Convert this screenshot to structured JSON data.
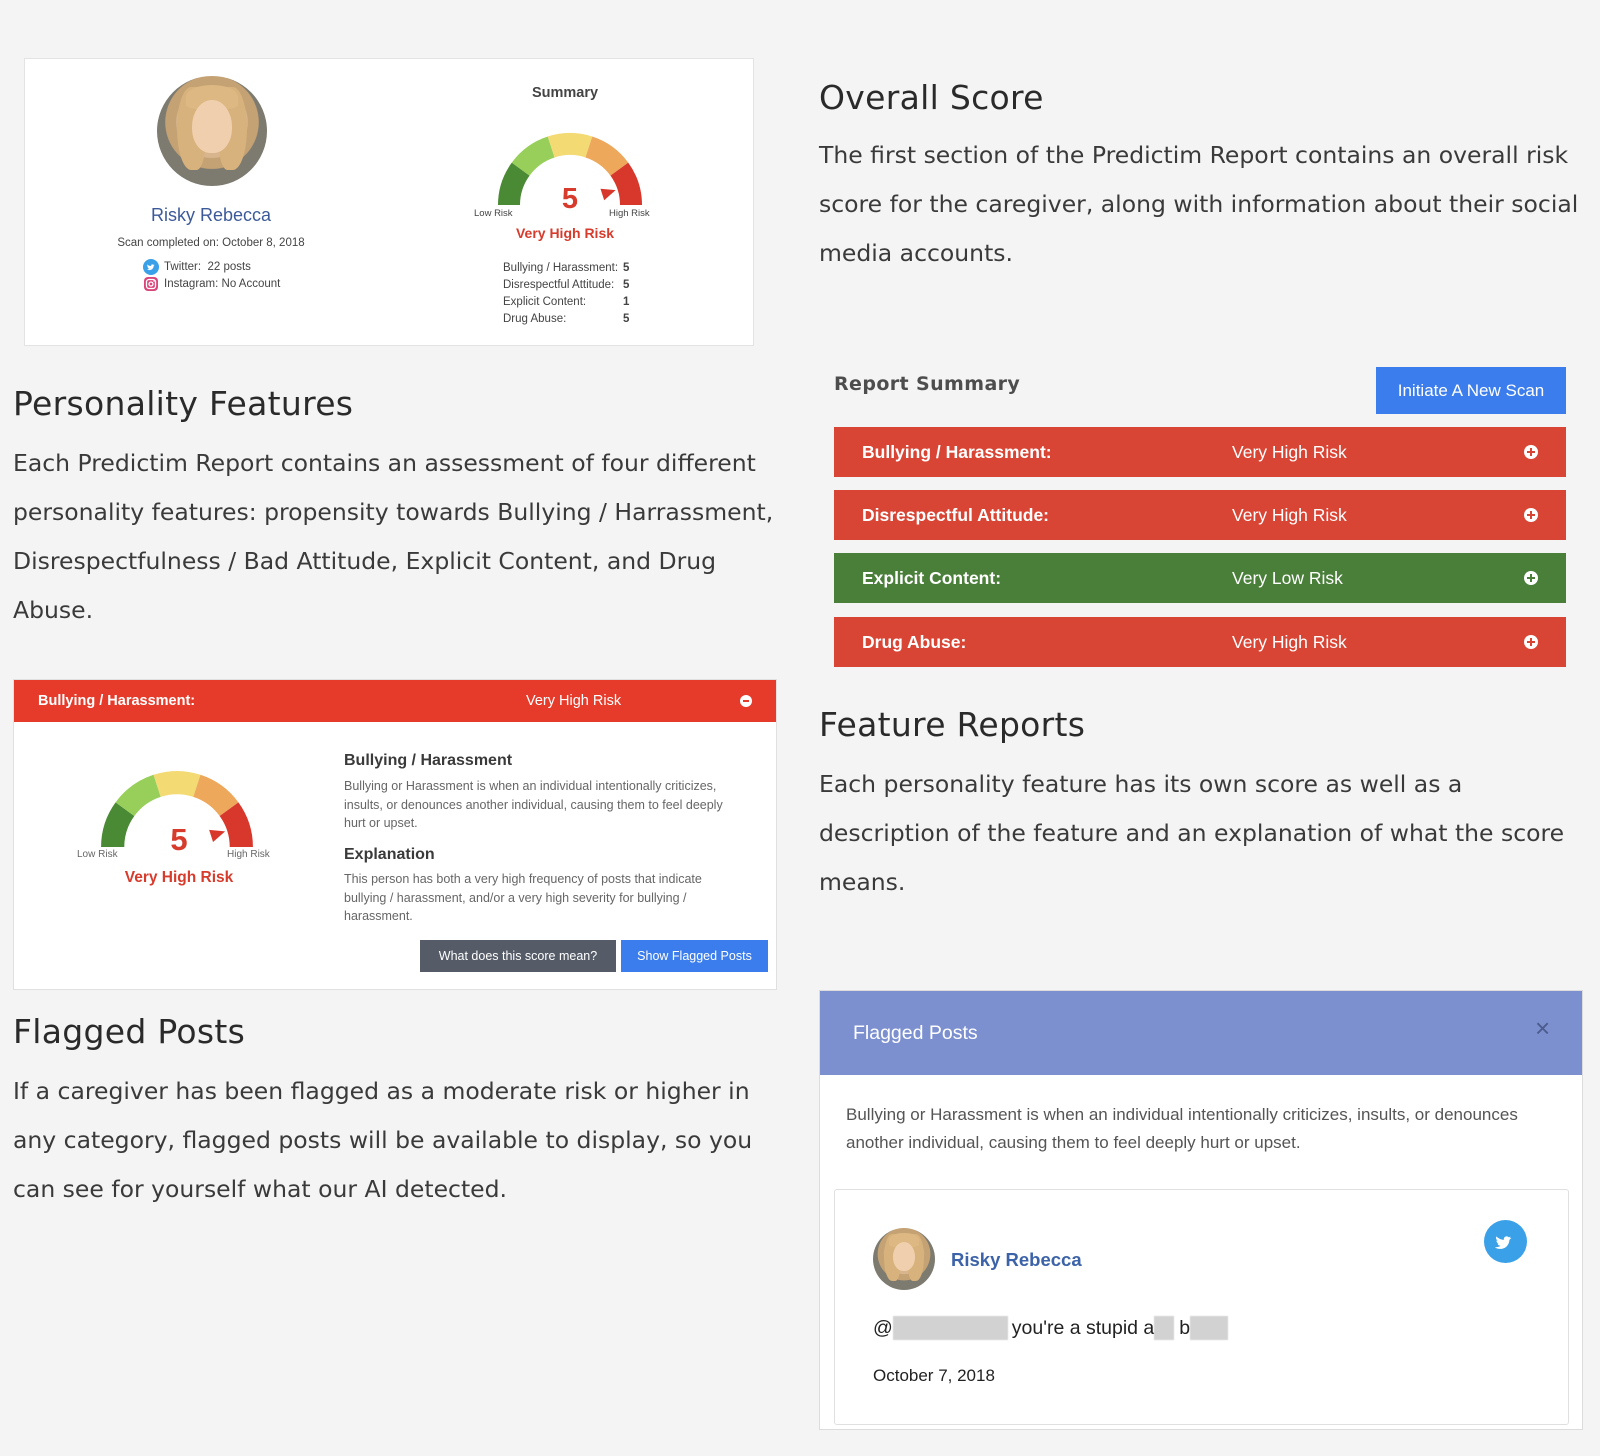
{
  "overall": {
    "title": "Overall Score",
    "body": "The first section of the Predictim Report contains an overall risk score for the caregiver, along with information about their social media accounts."
  },
  "summary_card": {
    "name": "Risky Rebecca",
    "scan_completed": "Scan completed on: October 8, 2018",
    "twitter_label": "Twitter:",
    "twitter_value": "22 posts",
    "instagram_label": "Instagram:",
    "instagram_value": "No Account",
    "summary_title": "Summary",
    "gauge": {
      "score": 5,
      "max": 5,
      "low_label": "Low Risk",
      "high_label": "High Risk",
      "risk_text": "Very High Risk"
    },
    "scores": [
      {
        "label": "Bullying / Harassment:",
        "value": "5"
      },
      {
        "label": "Disrespectful Attitude:",
        "value": "5"
      },
      {
        "label": "Explicit Content:",
        "value": "1"
      },
      {
        "label": "Drug Abuse:",
        "value": "5"
      }
    ]
  },
  "personality": {
    "title": "Personality Features",
    "body": "Each Predictim Report contains an assessment of four different personality features: propensity towards Bullying / Harrassment, Disrespectfulness / Bad Attitude, Explicit Content, and Drug Abuse."
  },
  "report_summary": {
    "title": "Report Summary",
    "button": "Initiate A New Scan",
    "rows": [
      {
        "label": "Bullying / Harassment:",
        "value": "Very High Risk"
      },
      {
        "label": "Disrespectful Attitude:",
        "value": "Very High Risk"
      },
      {
        "label": "Explicit Content:",
        "value": "Very Low Risk"
      },
      {
        "label": "Drug Abuse:",
        "value": "Very High Risk"
      }
    ]
  },
  "feature_panel": {
    "header_label": "Bullying / Harassment:",
    "header_value": "Very High Risk",
    "gauge": {
      "score": 5,
      "low_label": "Low Risk",
      "high_label": "High Risk",
      "risk_text": "Very High Risk"
    },
    "heading": "Bullying / Harassment",
    "description": "Bullying or Harassment is when an individual intentionally criticizes, insults, or denounces another individual, causing them to feel deeply hurt or upset.",
    "explanation_heading": "Explanation",
    "explanation": "This person has both a very high frequency of posts that indicate bullying / harassment, and/or a very high severity for bullying / harassment.",
    "btn_score": "What does this score mean?",
    "btn_flagged": "Show Flagged Posts"
  },
  "feature_reports": {
    "title": "Feature Reports",
    "body": "Each personality feature has its own score as well as a description of the feature and an explanation of what the score means."
  },
  "flagged": {
    "title": "Flagged Posts",
    "body": "If a caregiver has been flagged as a moderate risk or higher in any category, flagged posts will be available to display, so you can see for yourself what our AI detected."
  },
  "modal": {
    "title": "Flagged Posts",
    "close": "×",
    "description": "Bullying or Harassment is when an individual intentionally criticizes, insults, or denounces another individual, causing them to feel deeply hurt or upset.",
    "post": {
      "author": "Risky Rebecca",
      "at": "@",
      "text_mid": "you're a stupid a",
      "text_b": "b",
      "date": "October 7, 2018"
    }
  },
  "colors": {
    "very_high": "#d94535",
    "very_low": "#4a7f3a",
    "panel_header": "#e63a2a",
    "modal_header": "#7c8fcf",
    "accent_blue": "#3b7ded",
    "gauge": [
      "#4a8a34",
      "#97cf5a",
      "#f3da72",
      "#eda85c",
      "#d8382c"
    ]
  }
}
